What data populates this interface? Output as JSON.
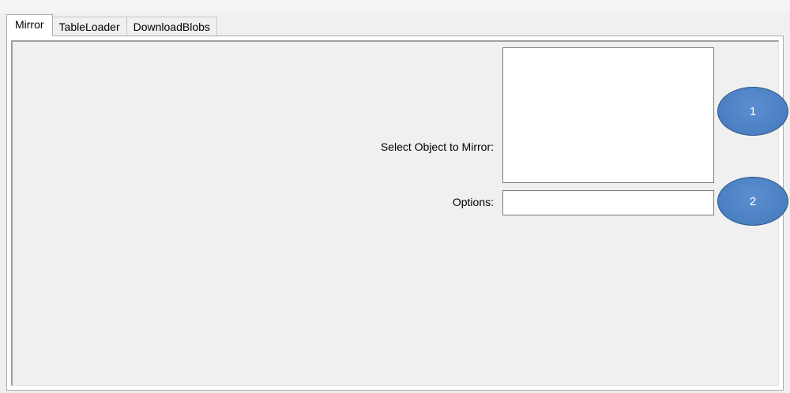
{
  "tabs": [
    {
      "label": "Mirror",
      "active": true
    },
    {
      "label": "TableLoader",
      "active": false
    },
    {
      "label": "DownloadBlobs",
      "active": false
    }
  ],
  "mirror_page": {
    "select_object_label": "Select Object to Mirror:",
    "options_label": "Options:",
    "options_value": ""
  },
  "callouts": [
    {
      "number": "1"
    },
    {
      "number": "2"
    }
  ],
  "colors": {
    "callout_fill": "#4a7fc1",
    "callout_border": "#2e5586",
    "window_background": "#f0f0f0"
  }
}
